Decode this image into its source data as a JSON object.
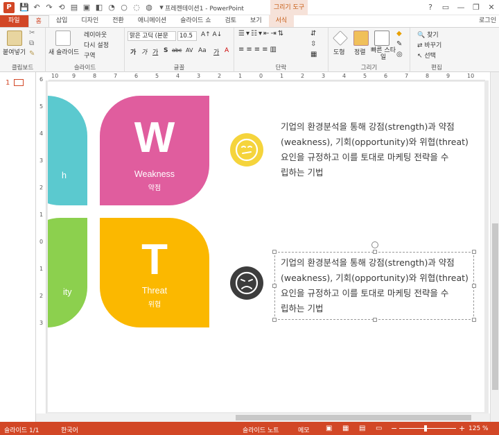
{
  "window": {
    "app_badge": "P",
    "title": "프레젠테이션1 - PowerPoint",
    "tool_context": "그리기 도구",
    "controls": [
      "?",
      "▭",
      "—",
      "❐",
      "✕"
    ]
  },
  "quick_access": [
    "💾",
    "↶",
    "↷",
    "⟲",
    "▤",
    "▣",
    "◧",
    "◔",
    "○",
    "◌",
    "◍",
    "▾"
  ],
  "tabs": [
    {
      "label": "파일"
    },
    {
      "label": "홈"
    },
    {
      "label": "삽입"
    },
    {
      "label": "디자인"
    },
    {
      "label": "전환"
    },
    {
      "label": "애니메이션"
    },
    {
      "label": "슬라이드 쇼"
    },
    {
      "label": "검토"
    },
    {
      "label": "보기"
    },
    {
      "label": "서식"
    },
    {
      "label": "로그인"
    }
  ],
  "ribbon": {
    "clipboard": {
      "label": "클립보드",
      "paste": "붙여넣기"
    },
    "slides": {
      "label": "슬라이드",
      "new_slide": "새 슬라이드",
      "layout": "레이아웃",
      "reset": "다시 설정",
      "section": "구역"
    },
    "font": {
      "label": "글꼴",
      "font_name": "맑은 고딕 (본문",
      "font_size": "10.5",
      "styles": [
        "가",
        "가",
        "가",
        "S",
        "abc",
        "AV",
        "Aa",
        "가",
        "A"
      ]
    },
    "paragraph": {
      "label": "단락"
    },
    "drawing": {
      "label": "그리기",
      "shapes": "도형",
      "arrange": "정렬",
      "quick_styles": "빠른 스타일"
    },
    "editing": {
      "label": "편집",
      "find": "찾기",
      "replace": "바꾸기",
      "select": "선택"
    }
  },
  "ruler_h": [
    "10",
    "9",
    "8",
    "7",
    "6",
    "5",
    "4",
    "3",
    "2",
    "1",
    "0",
    "1",
    "2",
    "3",
    "4",
    "5",
    "6",
    "7",
    "8",
    "9",
    "10"
  ],
  "ruler_v": [
    "6",
    "5",
    "4",
    "3",
    "2",
    "1",
    "0",
    "1",
    "2",
    "3"
  ],
  "thumbnail": {
    "number": "1"
  },
  "slide": {
    "quadrants": {
      "s": {
        "en": "h",
        "color": "#5bc9cf"
      },
      "w": {
        "letter": "W",
        "en": "Weakness",
        "ko": "약점",
        "color": "#e05d9e"
      },
      "o": {
        "en": "ity",
        "color": "#8cd04e"
      },
      "t": {
        "letter": "T",
        "en": "Threat",
        "ko": "위협",
        "color": "#fbb800"
      }
    },
    "face_neutral_color": "#f5d43c",
    "face_sad_color": "#3d3d3d",
    "text1": {
      "line1": "기업의 환경분석을 통해 강점(strength)과 약점",
      "line2": "(weakness), 기회(opportunity)와 위협(threat)",
      "line3": "요인을 규정하고 이를 토대로 마케팅 전략을 수",
      "line4": "립하는 기법"
    },
    "text2": {
      "line1": "기업의 환경분석을 통해 강점(strength)과 약점",
      "line2": "(weakness), 기회(opportunity)와 위협(threat)",
      "line3": "요인을 규정하고 이를 토대로 마케팅 전략을 수",
      "line4": "립하는 기법"
    }
  },
  "statusbar": {
    "slide_count": "슬라이드 1/1",
    "language": "한국어",
    "notes": "슬라이드 노트",
    "comments": "메모",
    "zoom": "125 %",
    "zoom_minus": "−",
    "zoom_plus": "+"
  },
  "colors": {
    "accent": "#d24726"
  }
}
